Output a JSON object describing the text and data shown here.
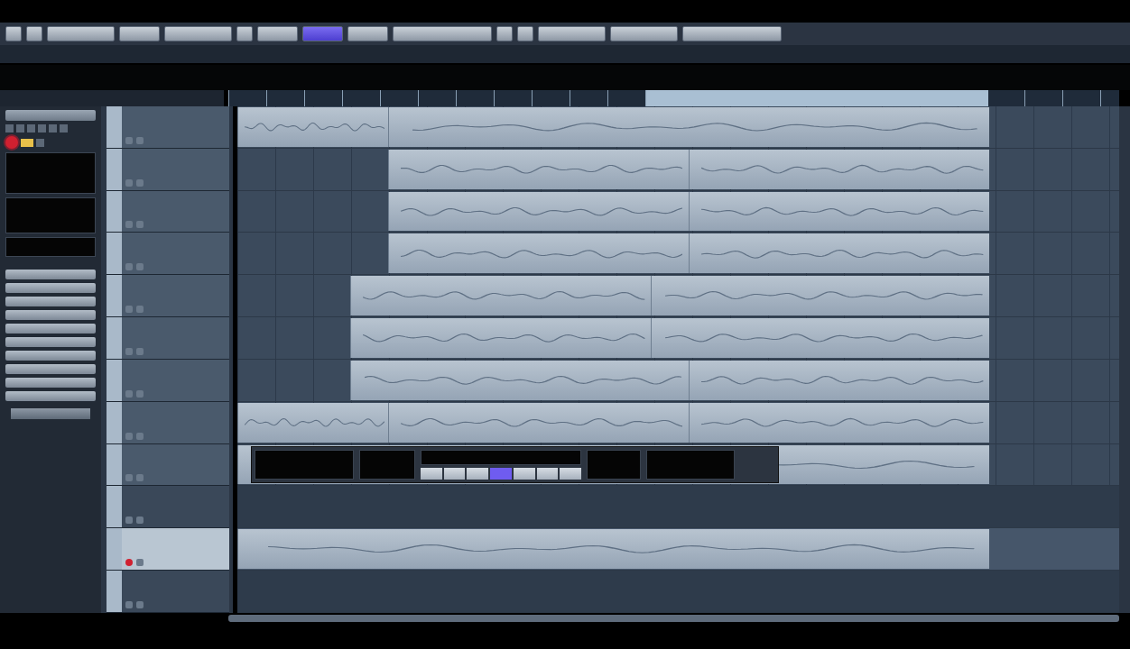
{
  "toolbar": {
    "buttons": [
      {
        "kind": "icon",
        "selected": false
      },
      {
        "kind": "icon",
        "selected": false
      },
      {
        "kind": "wide",
        "selected": false
      },
      {
        "kind": "narrow",
        "selected": false
      },
      {
        "kind": "wide",
        "selected": false
      },
      {
        "kind": "icon",
        "selected": false
      },
      {
        "kind": "narrow",
        "selected": false
      },
      {
        "kind": "narrow",
        "selected": true
      },
      {
        "kind": "narrow",
        "selected": false
      },
      {
        "kind": "long",
        "selected": false
      },
      {
        "kind": "icon",
        "selected": false
      },
      {
        "kind": "icon",
        "selected": false
      },
      {
        "kind": "wide",
        "selected": false
      },
      {
        "kind": "wide",
        "selected": false
      },
      {
        "kind": "long",
        "selected": false
      }
    ]
  },
  "inspector": {
    "record_enabled": true,
    "monitor_enabled": true,
    "sections": [
      {
        "expanded": false
      },
      {
        "expanded": false
      },
      {
        "expanded": false
      },
      {
        "expanded": false
      },
      {
        "expanded": false
      },
      {
        "expanded": false
      },
      {
        "expanded": false
      },
      {
        "expanded": false
      },
      {
        "expanded": false
      },
      {
        "expanded": false
      }
    ]
  },
  "tracks": [
    {
      "kind": "audio",
      "selected": false,
      "record_armed": false,
      "parts": [
        {
          "kind": "audio"
        },
        {
          "kind": "audio"
        }
      ]
    },
    {
      "kind": "audio",
      "selected": false,
      "record_armed": false,
      "parts": [
        {
          "kind": "audio"
        },
        {
          "kind": "audio"
        }
      ]
    },
    {
      "kind": "audio",
      "selected": false,
      "record_armed": false,
      "parts": [
        {
          "kind": "audio"
        },
        {
          "kind": "audio"
        }
      ]
    },
    {
      "kind": "audio",
      "selected": false,
      "record_armed": false,
      "parts": [
        {
          "kind": "audio"
        },
        {
          "kind": "audio"
        }
      ]
    },
    {
      "kind": "audio",
      "selected": false,
      "record_armed": false,
      "parts": [
        {
          "kind": "audio"
        },
        {
          "kind": "audio"
        }
      ]
    },
    {
      "kind": "audio",
      "selected": false,
      "record_armed": false,
      "parts": [
        {
          "kind": "audio"
        },
        {
          "kind": "audio"
        }
      ]
    },
    {
      "kind": "audio",
      "selected": false,
      "record_armed": false,
      "parts": [
        {
          "kind": "audio"
        },
        {
          "kind": "audio"
        }
      ]
    },
    {
      "kind": "audio",
      "selected": false,
      "record_armed": false,
      "parts": [
        {
          "kind": "audio"
        },
        {
          "kind": "audio"
        },
        {
          "kind": "audio"
        }
      ]
    },
    {
      "kind": "audio",
      "selected": false,
      "record_armed": false,
      "parts": [
        {
          "kind": "audio"
        }
      ]
    },
    {
      "kind": "folder",
      "selected": false,
      "record_armed": false
    },
    {
      "kind": "audio",
      "selected": true,
      "record_armed": true,
      "parts": [
        {
          "kind": "audio"
        }
      ]
    },
    {
      "kind": "folder",
      "selected": false,
      "record_armed": false
    }
  ],
  "transport": {
    "buttons": [
      {
        "selected": false
      },
      {
        "selected": false
      },
      {
        "selected": false
      },
      {
        "selected": true
      },
      {
        "selected": false
      },
      {
        "selected": false
      },
      {
        "selected": false
      }
    ]
  }
}
